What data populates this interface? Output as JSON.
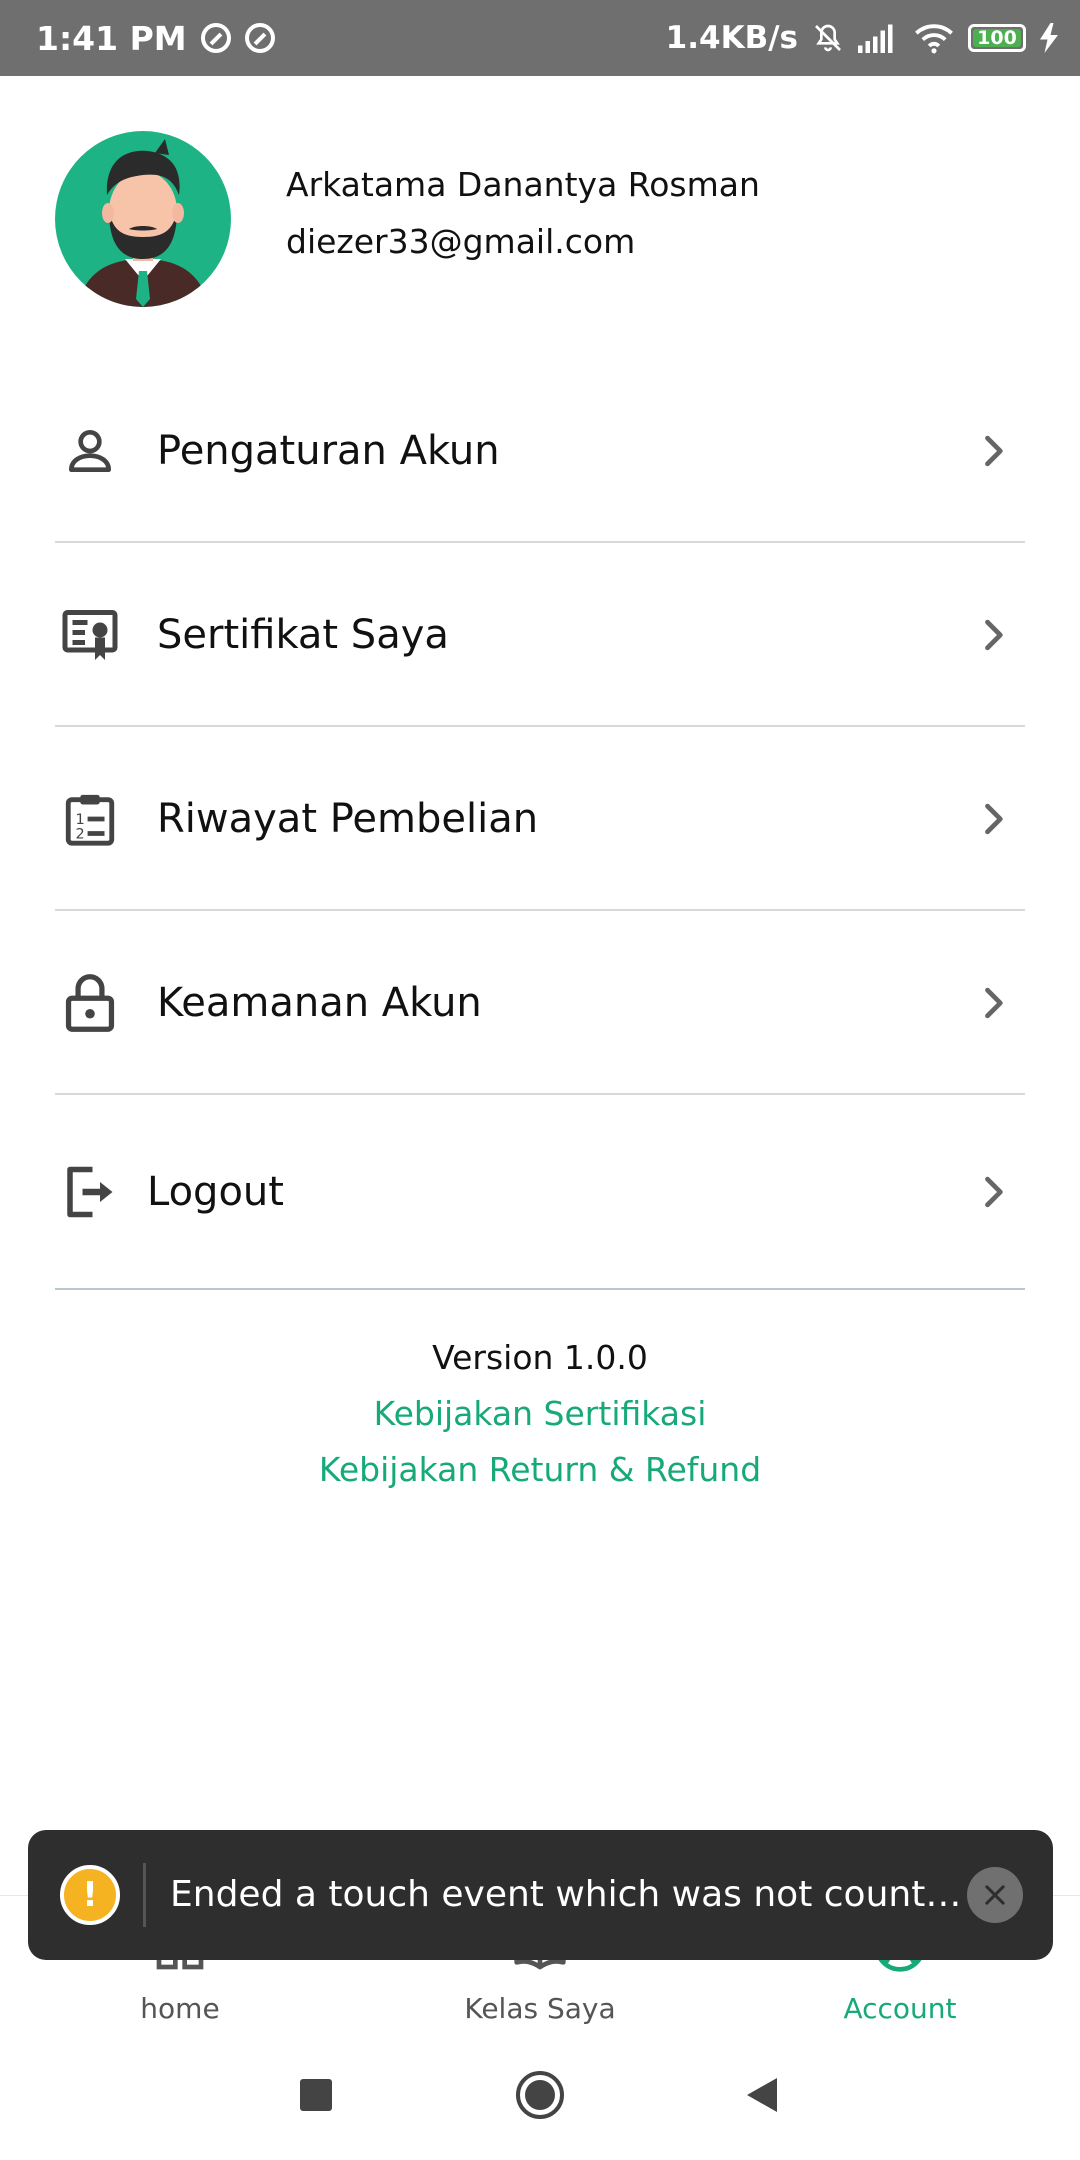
{
  "status_bar": {
    "time": "1:41 PM",
    "network_speed": "1.4KB/s",
    "battery_level": "100",
    "icons": [
      "sync-icon",
      "sync-icon",
      "mute-icon",
      "signal-icon",
      "wifi-icon",
      "battery-icon",
      "charging-icon"
    ]
  },
  "profile": {
    "name": "Arkatama Danantya Rosman",
    "email": "diezer33@gmail.com"
  },
  "menu": {
    "items": [
      {
        "label": "Pengaturan Akun",
        "icon": "person-icon"
      },
      {
        "label": "Sertifikat Saya",
        "icon": "certificate-icon"
      },
      {
        "label": "Riwayat Pembelian",
        "icon": "clipboard-list-icon"
      },
      {
        "label": "Keamanan Akun",
        "icon": "lock-icon"
      },
      {
        "label": "Logout",
        "icon": "logout-icon"
      }
    ]
  },
  "footer": {
    "version": "Version 1.0.0",
    "links": [
      "Kebijakan Sertifikasi",
      "Kebijakan Return & Refund"
    ]
  },
  "bottom_nav": {
    "items": [
      {
        "label": "home",
        "icon": "home-grid-icon",
        "active": false
      },
      {
        "label": "Kelas Saya",
        "icon": "book-icon",
        "active": false
      },
      {
        "label": "Account",
        "icon": "account-circle-icon",
        "active": true
      }
    ]
  },
  "toast": {
    "message": "Ended a touch event which was not counte…"
  },
  "colors": {
    "accent": "#18a97a",
    "avatar_bg": "#1db385",
    "toast_bg": "#2e2e2e",
    "warning": "#f6b321"
  }
}
